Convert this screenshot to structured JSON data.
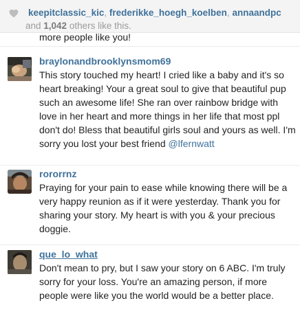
{
  "likes": {
    "icon": "heart-icon",
    "users": [
      "keepitclassic_kic",
      "frederikke_hoegh_koelben",
      "annaandpc"
    ],
    "separator": ", ",
    "and_text": " and ",
    "count": "1,042",
    "others_text": " others like this."
  },
  "previous_comment_tail": "more people like you!",
  "comments": [
    {
      "username": "braylonandbrooklynsmom69",
      "text": "This story touched my heart! I cried like a baby and it's so heart breaking! Your a great soul to give that beautiful pup such an awesome life! She ran over rainbow bridge with love in her heart and more things in her life that most ppl don't do! Bless that beautiful girls soul and yours as well. I'm sorry you lost your best friend ",
      "mention": "@lfernwatt"
    },
    {
      "username": "rororrnz",
      "text": "Praying for your pain to ease while knowing there will be a very happy reunion as if it were yesterday. Thank you for sharing your story. My heart is with you & your precious doggie."
    },
    {
      "username": "que_lo_what",
      "text": "Don't mean to pry, but I saw your story on 6 ABC. I'm truly sorry for your loss. You're an amazing person, if more people were like you the world would be a better place."
    }
  ],
  "colors": {
    "link": "#3f729b",
    "text": "#222222",
    "muted": "#9b9b9b",
    "heart": "#bdbdbd"
  }
}
